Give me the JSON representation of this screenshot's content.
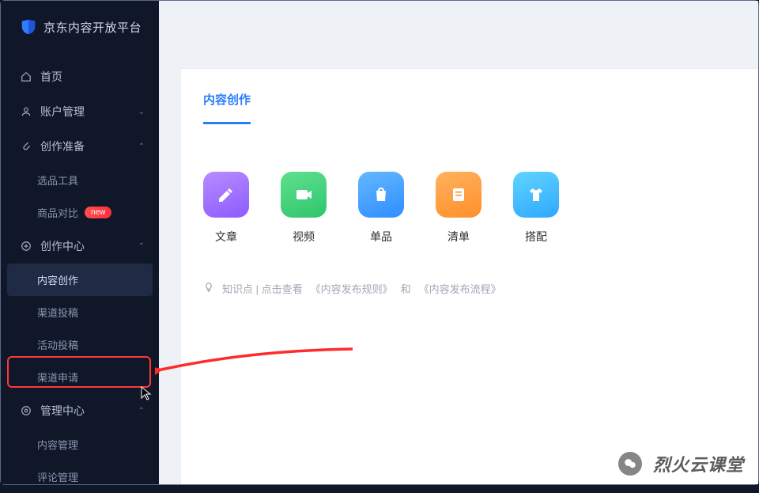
{
  "brand": {
    "name": "京东内容开放平台"
  },
  "sidebar": {
    "home": "首页",
    "account": "账户管理",
    "prep": "创作准备",
    "prep_sub": {
      "tool": "选品工具",
      "compare": "商品对比",
      "badge_new": "new"
    },
    "create": "创作中心",
    "create_sub": {
      "content": "内容创作",
      "channel_post": "渠道投稿",
      "activity_post": "活动投稿",
      "channel_apply": "渠道申请"
    },
    "manage": "管理中心",
    "manage_sub": {
      "content_mgmt": "内容管理",
      "comment_mgmt": "评论管理"
    }
  },
  "main": {
    "tab_active": "内容创作",
    "tiles": {
      "article": "文章",
      "video": "视频",
      "single": "单品",
      "list": "清单",
      "outfit": "搭配"
    },
    "hint_prefix": "知识点 | 点击查看",
    "hint_link1": "《内容发布规则》",
    "hint_mid": "和",
    "hint_link2": "《内容发布流程》"
  },
  "watermark": {
    "text": "烈火云课堂"
  }
}
